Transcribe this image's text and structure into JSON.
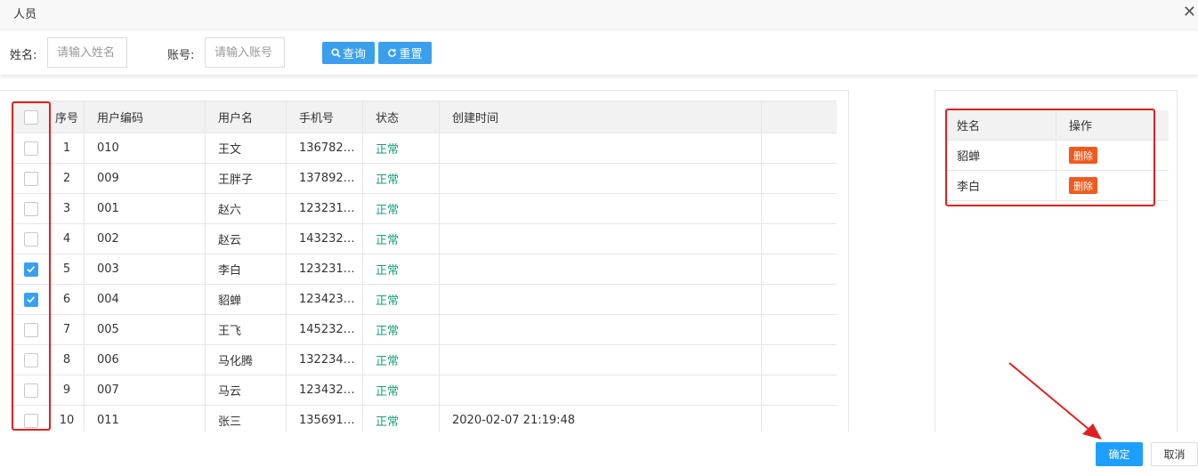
{
  "dialog": {
    "title": "人员",
    "close_symbol": "✕"
  },
  "search": {
    "name_label": "姓名:",
    "name_placeholder": "请输入姓名",
    "name_value": "",
    "account_label": "账号:",
    "account_placeholder": "请输入账号",
    "account_value": "",
    "query_label": "查询",
    "reset_label": "重置"
  },
  "user_table": {
    "columns": [
      "序号",
      "用户编码",
      "用户名",
      "手机号",
      "状态",
      "创建时间"
    ],
    "rows": [
      {
        "no": "1",
        "code": "010",
        "name": "王文",
        "phone": "136782…",
        "status": "正常",
        "created": "",
        "checked": false
      },
      {
        "no": "2",
        "code": "009",
        "name": "王胖子",
        "phone": "137892…",
        "status": "正常",
        "created": "",
        "checked": false
      },
      {
        "no": "3",
        "code": "001",
        "name": "赵六",
        "phone": "123231…",
        "status": "正常",
        "created": "",
        "checked": false
      },
      {
        "no": "4",
        "code": "002",
        "name": "赵云",
        "phone": "143232…",
        "status": "正常",
        "created": "",
        "checked": false
      },
      {
        "no": "5",
        "code": "003",
        "name": "李白",
        "phone": "123231…",
        "status": "正常",
        "created": "",
        "checked": true
      },
      {
        "no": "6",
        "code": "004",
        "name": "貂蝉",
        "phone": "123423…",
        "status": "正常",
        "created": "",
        "checked": true
      },
      {
        "no": "7",
        "code": "005",
        "name": "王飞",
        "phone": "145232…",
        "status": "正常",
        "created": "",
        "checked": false
      },
      {
        "no": "8",
        "code": "006",
        "name": "马化腾",
        "phone": "132234…",
        "status": "正常",
        "created": "",
        "checked": false
      },
      {
        "no": "9",
        "code": "007",
        "name": "马云",
        "phone": "123432…",
        "status": "正常",
        "created": "",
        "checked": false
      },
      {
        "no": "10",
        "code": "011",
        "name": "张三",
        "phone": "135691…",
        "status": "正常",
        "created": "2020-02-07 21:19:48",
        "checked": false
      }
    ]
  },
  "selected_table": {
    "columns": [
      "姓名",
      "操作"
    ],
    "rows": [
      {
        "name": "貂蝉",
        "action": "删除"
      },
      {
        "name": "李白",
        "action": "删除"
      }
    ]
  },
  "footer": {
    "confirm_label": "确定",
    "cancel_label": "取消"
  },
  "colors": {
    "primary": "#1e9fff",
    "search_button": "#3aa0ee",
    "delete_button": "#f05a1e",
    "status_ok": "#1a9e7a",
    "annotation": "#e02020"
  },
  "icons": {
    "query": "search-icon",
    "reset": "refresh-icon",
    "close": "close-icon",
    "checkbox_checked": "checkmark-icon"
  }
}
